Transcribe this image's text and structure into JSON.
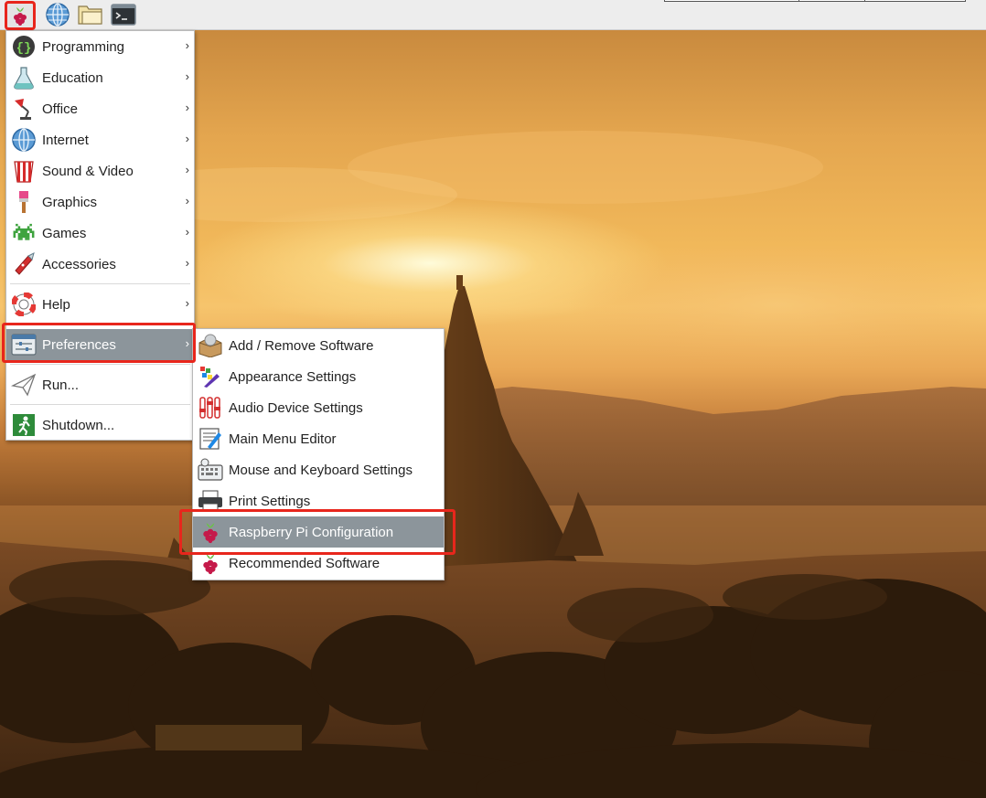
{
  "panel": {
    "launchers": [
      {
        "icon": "raspberry-icon"
      },
      {
        "icon": "globe-icon"
      },
      {
        "icon": "folder-icon"
      },
      {
        "icon": "terminal-icon"
      }
    ]
  },
  "main_menu": {
    "items": [
      {
        "label": "Programming",
        "icon": "programming-icon",
        "submenu": true
      },
      {
        "label": "Education",
        "icon": "flask-icon",
        "submenu": true
      },
      {
        "label": "Office",
        "icon": "office-lamp-icon",
        "submenu": true
      },
      {
        "label": "Internet",
        "icon": "globe-icon",
        "submenu": true
      },
      {
        "label": "Sound & Video",
        "icon": "popcorn-icon",
        "submenu": true
      },
      {
        "label": "Graphics",
        "icon": "paintbrush-icon",
        "submenu": true
      },
      {
        "label": "Games",
        "icon": "space-invader-icon",
        "submenu": true
      },
      {
        "label": "Accessories",
        "icon": "pocket-knife-icon",
        "submenu": true
      },
      {
        "label": "Help",
        "icon": "lifebuoy-icon",
        "submenu": true
      },
      {
        "label": "Preferences",
        "icon": "preferences-icon",
        "submenu": true,
        "highlighted": true
      },
      {
        "label": "Run...",
        "icon": "paper-plane-icon",
        "submenu": false
      },
      {
        "label": "Shutdown...",
        "icon": "running-man-icon",
        "submenu": false
      }
    ],
    "arrow_glyph": "›"
  },
  "preferences_menu": {
    "items": [
      {
        "label": "Add / Remove Software",
        "icon": "package-icon"
      },
      {
        "label": "Appearance Settings",
        "icon": "palette-icon"
      },
      {
        "label": "Audio Device Settings",
        "icon": "mixer-icon"
      },
      {
        "label": "Main Menu Editor",
        "icon": "menu-editor-icon"
      },
      {
        "label": "Mouse and Keyboard Settings",
        "icon": "keyboard-mouse-icon"
      },
      {
        "label": "Print Settings",
        "icon": "printer-icon"
      },
      {
        "label": "Raspberry Pi Configuration",
        "icon": "raspberry-icon",
        "highlighted": true
      },
      {
        "label": "Recommended Software",
        "icon": "raspberry-icon"
      }
    ]
  },
  "colors": {
    "highlight": "#8c959b",
    "annotation_red": "#e8261c",
    "raspberry": "#c51a4a",
    "leaf": "#6cc04a"
  }
}
